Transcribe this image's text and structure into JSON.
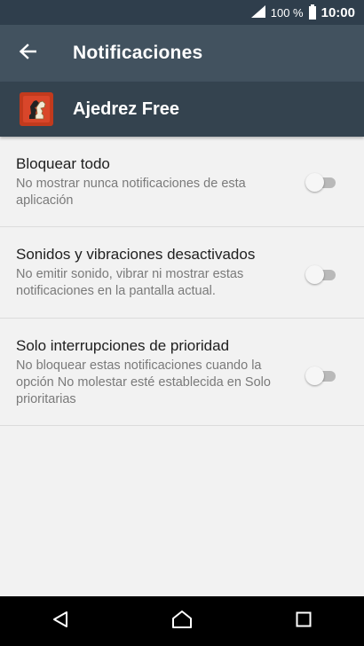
{
  "status_bar": {
    "battery_text": "100 %",
    "time": "10:00"
  },
  "app_bar": {
    "title": "Notificaciones",
    "back_icon": "arrow-left-icon"
  },
  "app_header": {
    "app_name": "Ajedrez Free",
    "icon": "chess-knight-icon",
    "icon_color": "#c23a1d"
  },
  "settings": [
    {
      "label": "Bloquear todo",
      "description": "No mostrar nunca notificaciones de esta aplicación",
      "enabled": false
    },
    {
      "label": "Sonidos y vibraciones desactivados",
      "description": "No emitir sonido, vibrar ni mostrar estas notificaciones en la pantalla actual.",
      "enabled": false
    },
    {
      "label": "Solo interrupciones de prioridad",
      "description": "No bloquear estas notificaciones cuando la opción No molestar esté establecida en Solo prioritarias",
      "enabled": false
    }
  ],
  "nav_bar": {
    "back": "triangle-back-icon",
    "home": "home-icon",
    "recents": "square-recents-icon"
  },
  "colors": {
    "app_bar": "#42525f",
    "header": "#34434f",
    "status_bar": "#2f3e4c",
    "background": "#f2f2f2"
  }
}
